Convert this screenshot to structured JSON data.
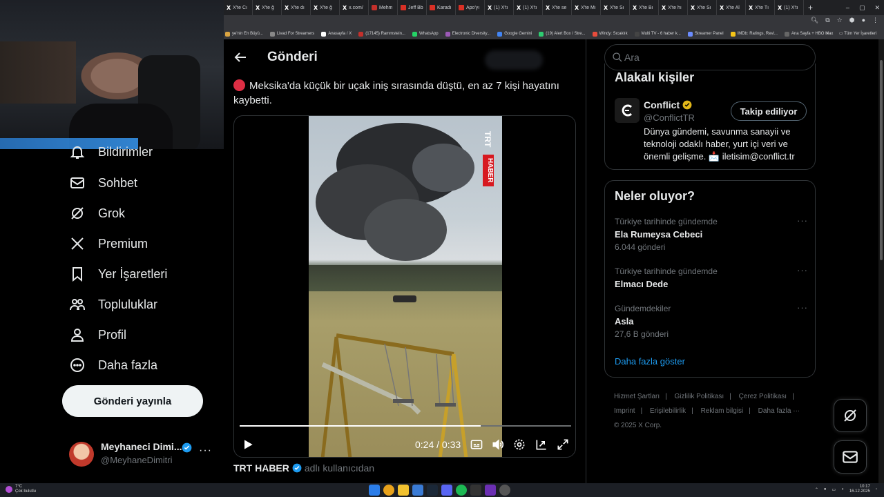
{
  "browser": {
    "tabs": [
      "X'te Cı",
      "X'te ğ",
      "X'te dı",
      "X'te ğ",
      "x.com/",
      "Mehm",
      "Jeff Bb",
      "Karadı",
      "Apo'yı",
      "(1) X'tı",
      "(1) X'tı",
      "X'te se",
      "X'te Mı",
      "X'te Sı",
      "X'te Bı",
      "X'te hı",
      "X'te Sı",
      "X'te Al",
      "X'te Tı",
      "(1) X'tı"
    ],
    "new_tab": "+",
    "bookmarks": [
      "ye'nin En Büyü...",
      "Livad For Streamers",
      "Anasayfa / X",
      "(17145) Rammstein...",
      "WhatsApp",
      "Electronic Diversity...",
      "Google Gemini",
      "(19) Alert Box / Stre...",
      "Windy: Sıcaklık",
      "Multi TV - 6 haber k...",
      "Streamer Panel",
      "IMDb: Ratings, Revi...",
      "Ana Sayfa + HBO Max"
    ],
    "bookmarks_more": "»",
    "all_bookmarks": "Tüm Yer İşaretleri"
  },
  "nav": {
    "items": [
      {
        "label": "Bildirimler",
        "icon": "bell-icon"
      },
      {
        "label": "Sohbet",
        "icon": "mail-icon"
      },
      {
        "label": "Grok",
        "icon": "grok-icon"
      },
      {
        "label": "Premium",
        "icon": "x-logo-icon"
      },
      {
        "label": "Yer İşaretleri",
        "icon": "bookmark-icon"
      },
      {
        "label": "Topluluklar",
        "icon": "communities-icon"
      },
      {
        "label": "Profil",
        "icon": "person-icon"
      },
      {
        "label": "Daha fazla",
        "icon": "more-circle-icon"
      }
    ],
    "post_button": "Gönderi yayınla",
    "account": {
      "name": "Meyhaneci Dimi...",
      "handle": "@MeyhaneDimitri"
    }
  },
  "main": {
    "title": "Gönderi",
    "post_text": "Meksika'da küçük bir uçak iniş sırasında düştü, en az 7 kişi hayatını kaybetti.",
    "video": {
      "current_time": "0:24",
      "duration": "0:33",
      "progress": 0.727,
      "watermark_top": "TRT",
      "watermark_bottom": "HABER"
    },
    "source_name": "TRT HABER",
    "source_suffix": "adlı kullanıcıdan"
  },
  "right": {
    "search_placeholder": "Ara",
    "related_title": "Alakalı kişiler",
    "related": {
      "name": "Conflict",
      "handle": "@ConflictTR",
      "bio": "Dünya gündemi, savunma sanayii ve teknoloji odaklı haber, yurt içi veri ve önemli gelişme. 📩 iletisim@conflict.tr",
      "follow_label": "Takip ediliyor"
    },
    "trends_title": "Neler oluyor?",
    "trends": [
      {
        "context": "Türkiye tarihinde gündemde",
        "name": "Ela Rumeysa Cebeci",
        "count": "6.044 gönderi"
      },
      {
        "context": "Türkiye tarihinde gündemde",
        "name": "Elmacı Dede",
        "count": ""
      },
      {
        "context": "Gündemdekiler",
        "name": "Asla",
        "count": "27,6 B gönderi"
      }
    ],
    "show_more": "Daha fazla göster",
    "footer": [
      "Hizmet Şartları",
      "Gizlilik Politikası",
      "Çerez Politikası",
      "Imprint",
      "Erişilebilirlik",
      "Reklam bilgisi",
      "Daha fazla ···"
    ],
    "copyright": "© 2025 X Corp."
  },
  "taskbar": {
    "weather_temp": "7°C",
    "weather_desc": "Çok bulutlu",
    "time": "10:17",
    "date": "16.12.2025"
  }
}
